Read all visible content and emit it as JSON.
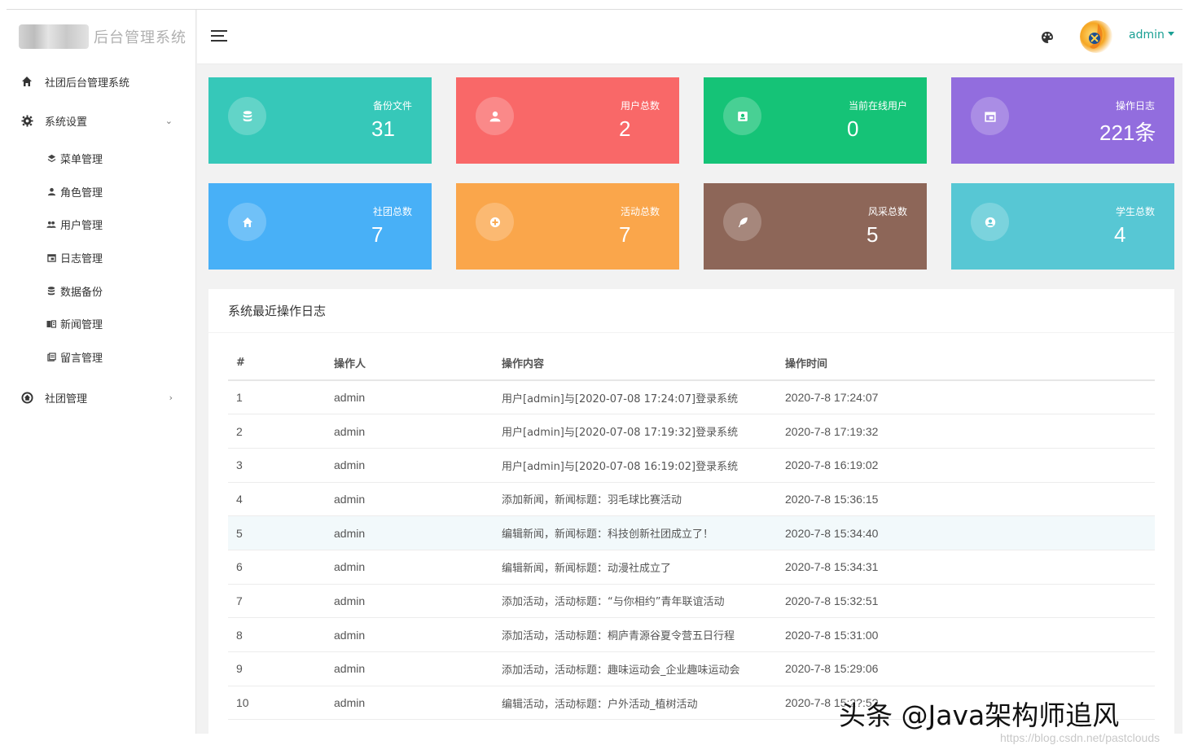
{
  "app": {
    "title": "后台管理系统"
  },
  "sidebar": {
    "top_item": {
      "label": "社团后台管理系统",
      "icon": "home-icon"
    },
    "settings": {
      "label": "系统设置",
      "icon": "gear-icon",
      "arrow": "⌄"
    },
    "sub_items": [
      {
        "label": "菜单管理",
        "icon": "layers-icon"
      },
      {
        "label": "角色管理",
        "icon": "user-icon"
      },
      {
        "label": "用户管理",
        "icon": "users-icon"
      },
      {
        "label": "日志管理",
        "icon": "calendar-icon"
      },
      {
        "label": "数据备份",
        "icon": "database-icon"
      },
      {
        "label": "新闻管理",
        "icon": "news-icon"
      },
      {
        "label": "留言管理",
        "icon": "message-icon"
      }
    ],
    "club": {
      "label": "社团管理",
      "icon": "club-icon",
      "arrow": "›"
    }
  },
  "header": {
    "user": "admin",
    "theme_icon": "palette-icon"
  },
  "cards": [
    {
      "title": "备份文件",
      "value": "31",
      "color": "#36c8b9",
      "icon": "database-icon"
    },
    {
      "title": "用户总数",
      "value": "2",
      "color": "#f96868",
      "icon": "user-icon"
    },
    {
      "title": "当前在线用户",
      "value": "0",
      "color": "#15c377",
      "icon": "id-card-icon"
    },
    {
      "title": "操作日志",
      "value": "221条",
      "color": "#926dde",
      "icon": "calendar-icon"
    },
    {
      "title": "社团总数",
      "value": "7",
      "color": "#48b0f7",
      "icon": "home-icon"
    },
    {
      "title": "活动总数",
      "value": "7",
      "color": "#faa64b",
      "icon": "plus-circle-icon"
    },
    {
      "title": "风采总数",
      "value": "5",
      "color": "#8d6658",
      "icon": "feather-icon"
    },
    {
      "title": "学生总数",
      "value": "4",
      "color": "#57c7d4",
      "icon": "student-icon"
    }
  ],
  "log_panel": {
    "title": "系统最近操作日志",
    "columns": [
      "#",
      "操作人",
      "操作内容",
      "操作时间"
    ],
    "rows": [
      {
        "id": "1",
        "user": "admin",
        "content": "用户[admin]与[2020-07-08 17:24:07]登录系统",
        "time": "2020-7-8 17:24:07"
      },
      {
        "id": "2",
        "user": "admin",
        "content": "用户[admin]与[2020-07-08 17:19:32]登录系统",
        "time": "2020-7-8 17:19:32"
      },
      {
        "id": "3",
        "user": "admin",
        "content": "用户[admin]与[2020-07-08 16:19:02]登录系统",
        "time": "2020-7-8 16:19:02"
      },
      {
        "id": "4",
        "user": "admin",
        "content": "添加新闻，新闻标题：羽毛球比赛活动",
        "time": "2020-7-8 15:36:15"
      },
      {
        "id": "5",
        "user": "admin",
        "content": "编辑新闻，新闻标题：科技创新社团成立了！",
        "time": "2020-7-8 15:34:40"
      },
      {
        "id": "6",
        "user": "admin",
        "content": "编辑新闻，新闻标题：动漫社成立了",
        "time": "2020-7-8 15:34:31"
      },
      {
        "id": "7",
        "user": "admin",
        "content": "添加活动，活动标题：“与你相约”青年联谊活动",
        "time": "2020-7-8 15:32:51"
      },
      {
        "id": "8",
        "user": "admin",
        "content": "添加活动，活动标题：桐庐青源谷夏令营五日行程",
        "time": "2020-7-8 15:31:00"
      },
      {
        "id": "9",
        "user": "admin",
        "content": "添加活动，活动标题：趣味运动会_企业趣味运动会",
        "time": "2020-7-8 15:29:06"
      },
      {
        "id": "10",
        "user": "admin",
        "content": "编辑活动，活动标题：户外活动_植树活动",
        "time": "2020-7-8 15:2?:5?"
      }
    ]
  },
  "watermark": {
    "text": "头条 @Java架构师追风",
    "url": "https://blog.csdn.net/pastclouds"
  }
}
